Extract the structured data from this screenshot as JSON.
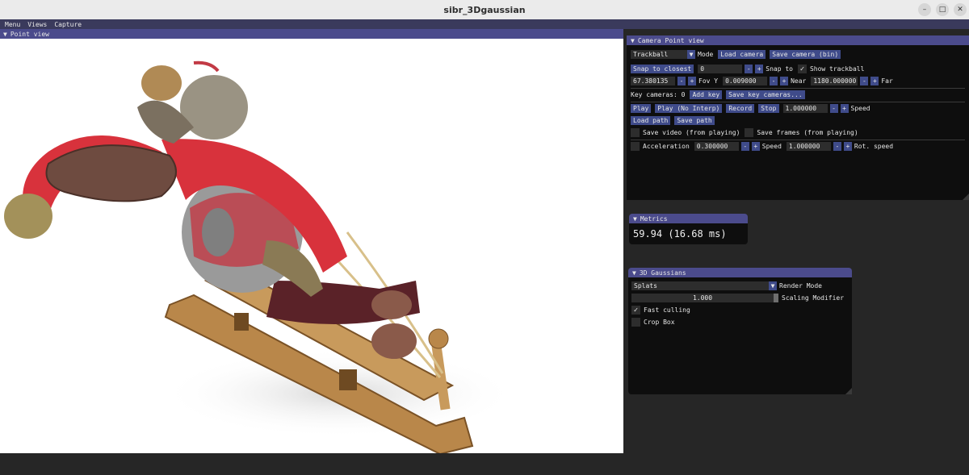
{
  "window": {
    "title": "sibr_3Dgaussian",
    "min_icon": "minimize-icon",
    "max_icon": "maximize-icon",
    "close_icon": "close-icon"
  },
  "menubar": {
    "items": [
      "Menu",
      "Views",
      "Capture"
    ]
  },
  "point_view": {
    "title": "Point view"
  },
  "camera_panel": {
    "title": "Camera Point view",
    "mode_value": "Trackball",
    "mode_label": "Mode",
    "load_camera": "Load camera",
    "save_camera": "Save camera (bin)",
    "snap_closest": "Snap to closest",
    "snap_value": "0",
    "snap_to": "Snap to",
    "show_trackball": "Show trackball",
    "fov_value": "67.380135",
    "fov_label": "Fov Y",
    "near_value": "0.009000",
    "near_label": "Near",
    "far_value": "1180.000000",
    "far_label": "Far",
    "key_cameras": "Key cameras: 0",
    "add_key": "Add key",
    "save_key_cameras": "Save key cameras...",
    "play": "Play",
    "play_no_interp": "Play (No Interp)",
    "record": "Record",
    "stop": "Stop",
    "speed_value": "1.000000",
    "speed_label": "Speed",
    "load_path": "Load path",
    "save_path": "Save path",
    "save_video": "Save video (from playing)",
    "save_frames": "Save frames (from playing)",
    "acceleration_label": "Acceleration",
    "acceleration_value": "0.300000",
    "speed2_label": "Speed",
    "speed2_value": "1.000000",
    "rot_speed_label": "Rot. speed",
    "minus": "-",
    "plus": "+"
  },
  "metrics_panel": {
    "title": "Metrics",
    "fps": "59.94 (16.68 ms)"
  },
  "gaussians_panel": {
    "title": "3D Gaussians",
    "render_mode_value": "Splats",
    "render_mode_label": "Render Mode",
    "scaling_value": "1.000",
    "scaling_label": "Scaling Modifier",
    "fast_culling": "Fast culling",
    "crop_box": "Crop Box"
  },
  "colors": {
    "title_bar": "#4b4b8c",
    "button": "#3f4b8a",
    "panel_bg": "#0e0e0e",
    "field": "#2d2d2d"
  }
}
